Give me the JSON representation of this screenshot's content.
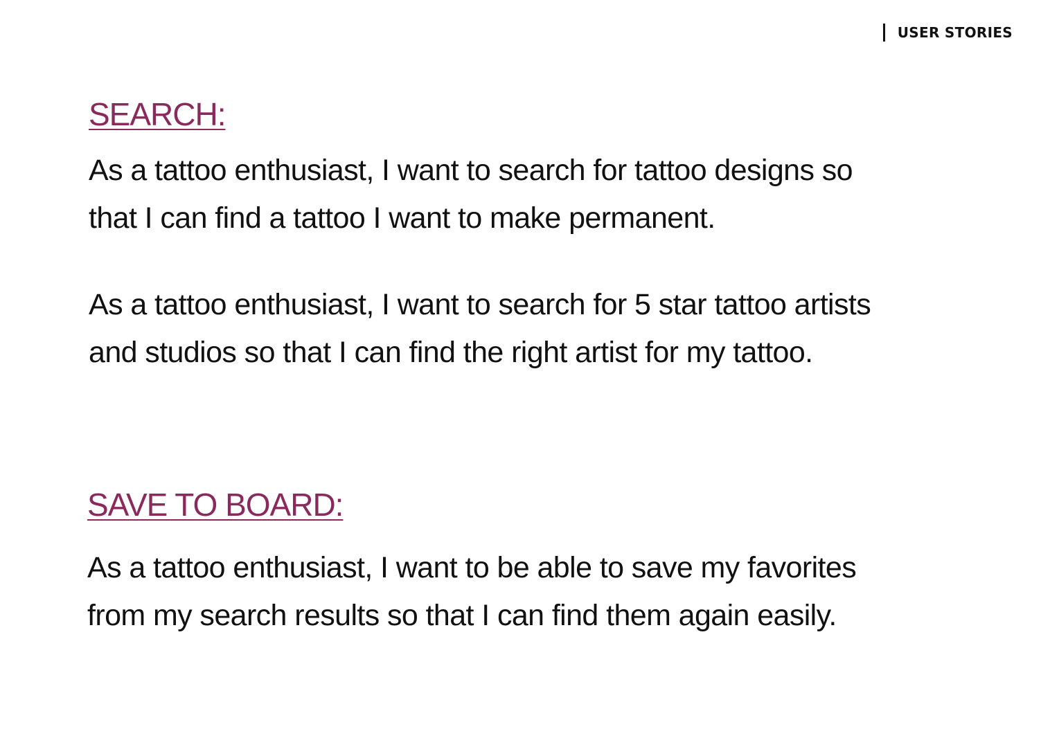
{
  "header": {
    "label": "USER STORIES"
  },
  "sections": [
    {
      "heading": "SEARCH:",
      "stories": [
        {
          "lines": [
            "As a tattoo enthusiast, I want to search for tattoo designs so",
            "that I can find a tattoo I want to make permanent."
          ]
        },
        {
          "lines": [
            "As a tattoo enthusiast, I want to search for 5 star tattoo artists",
            "and studios so that I can find the right artist for my tattoo."
          ]
        }
      ]
    },
    {
      "heading": "SAVE TO BOARD:",
      "stories": [
        {
          "lines": [
            "As a tattoo enthusiast, I want to be able to save my favorites",
            "from my search results so that I can find them again easily."
          ]
        }
      ]
    }
  ],
  "colors": {
    "heading": "#8a2a5c",
    "text": "#111111",
    "background": "#ffffff"
  }
}
